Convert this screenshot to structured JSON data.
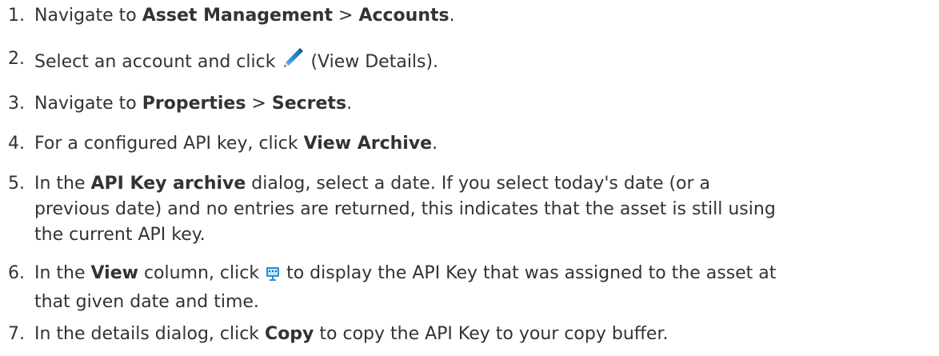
{
  "steps": [
    {
      "number": "1.",
      "t1": "Navigate to ",
      "b1": "Asset Management",
      "t2": " > ",
      "b2": "Accounts",
      "t3": "."
    },
    {
      "number": "2.",
      "t1": "Select an account and click ",
      "icon": "pencil-icon",
      "t2": " (View Details)."
    },
    {
      "number": "3.",
      "t1": "Navigate to ",
      "b1": "Properties",
      "t2": " > ",
      "b2": "Secrets",
      "t3": "."
    },
    {
      "number": "4.",
      "t1": "For a configured API key, click ",
      "b1": "View Archive",
      "t2": "."
    },
    {
      "number": "5.",
      "t1": "In the ",
      "b1": "API Key archive",
      "t2": " dialog, select a date. If you select today's date (or a",
      "line2": "previous date) and no entries are returned, this indicates that the asset is still using",
      "line3": "the current API key."
    },
    {
      "number": "6.",
      "t1": "In the ",
      "b1": "View",
      "t2": " column, click ",
      "icon": "view-monitor-icon",
      "t3": " to display the API Key that was assigned to the asset at",
      "line2": "that given date and time."
    },
    {
      "number": "7.",
      "t1": "In the details dialog, click ",
      "b1": "Copy",
      "t2": " to copy the API Key to your copy buffer."
    }
  ],
  "colors": {
    "text": "#333333",
    "pencil": "#2a8fd6",
    "monitor": "#2a8fd6"
  }
}
